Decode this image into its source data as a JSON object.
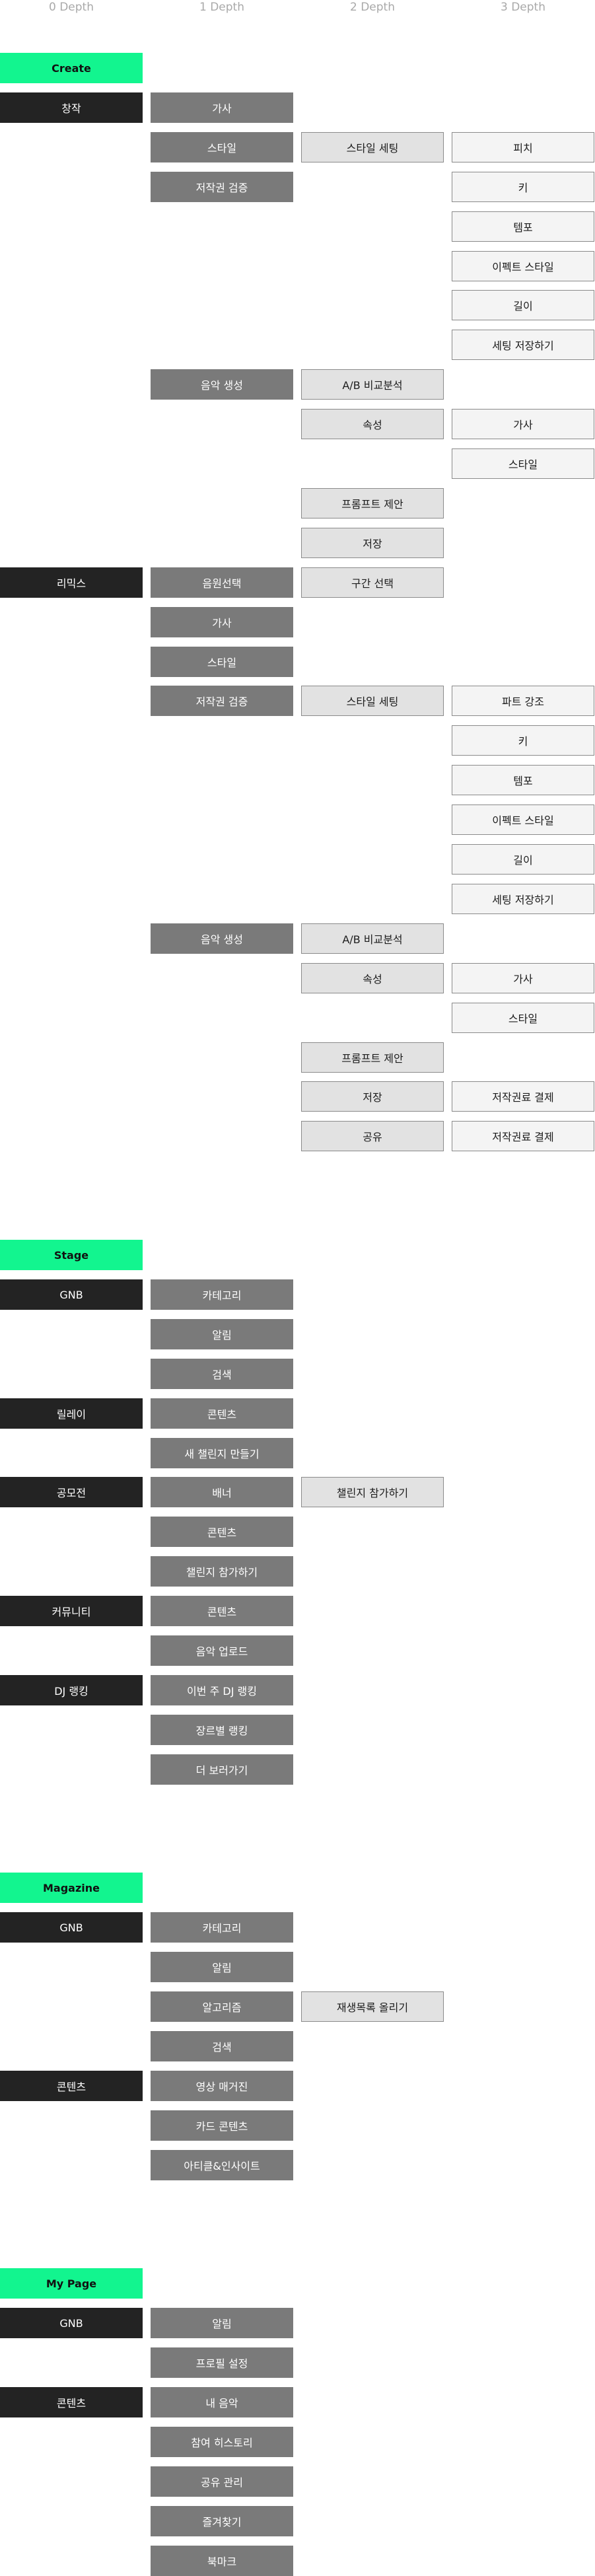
{
  "headers": [
    "0 Depth",
    "1 Depth",
    "2 Depth",
    "3 Depth"
  ],
  "nodes": [
    {
      "r": 0,
      "c": 0,
      "t": "section",
      "label": "Create"
    },
    {
      "r": 1,
      "c": 0,
      "t": "d0",
      "label": "창작"
    },
    {
      "r": 1,
      "c": 1,
      "t": "d1",
      "label": "가사"
    },
    {
      "r": 2,
      "c": 1,
      "t": "d1",
      "label": "스타일"
    },
    {
      "r": 2,
      "c": 2,
      "t": "d2",
      "label": "스타일 세팅"
    },
    {
      "r": 2,
      "c": 3,
      "t": "d3",
      "label": "피치"
    },
    {
      "r": 3,
      "c": 1,
      "t": "d1",
      "label": "저작권 검증"
    },
    {
      "r": 3,
      "c": 3,
      "t": "d3",
      "label": "키"
    },
    {
      "r": 4,
      "c": 3,
      "t": "d3",
      "label": "템포"
    },
    {
      "r": 5,
      "c": 3,
      "t": "d3",
      "label": "이펙트 스타일"
    },
    {
      "r": 6,
      "c": 3,
      "t": "d3",
      "label": "길이"
    },
    {
      "r": 7,
      "c": 3,
      "t": "d3",
      "label": "세팅 저장하기"
    },
    {
      "r": 8,
      "c": 1,
      "t": "d1",
      "label": "음악 생성"
    },
    {
      "r": 8,
      "c": 2,
      "t": "d2",
      "label": "A/B 비교분석"
    },
    {
      "r": 9,
      "c": 2,
      "t": "d2",
      "label": "속성"
    },
    {
      "r": 9,
      "c": 3,
      "t": "d3",
      "label": "가사"
    },
    {
      "r": 10,
      "c": 3,
      "t": "d3",
      "label": "스타일"
    },
    {
      "r": 11,
      "c": 2,
      "t": "d2",
      "label": "프롬프트 제안"
    },
    {
      "r": 12,
      "c": 2,
      "t": "d2",
      "label": "저장"
    },
    {
      "r": 13,
      "c": 0,
      "t": "d0",
      "label": "리믹스"
    },
    {
      "r": 13,
      "c": 1,
      "t": "d1",
      "label": "음원선택"
    },
    {
      "r": 13,
      "c": 2,
      "t": "d2",
      "label": "구간 선택"
    },
    {
      "r": 14,
      "c": 1,
      "t": "d1",
      "label": "가사"
    },
    {
      "r": 15,
      "c": 1,
      "t": "d1",
      "label": "스타일"
    },
    {
      "r": 16,
      "c": 1,
      "t": "d1",
      "label": "저작권 검증"
    },
    {
      "r": 16,
      "c": 2,
      "t": "d2",
      "label": "스타일 세팅"
    },
    {
      "r": 16,
      "c": 3,
      "t": "d3",
      "label": "파트 강조"
    },
    {
      "r": 17,
      "c": 3,
      "t": "d3",
      "label": "키"
    },
    {
      "r": 18,
      "c": 3,
      "t": "d3",
      "label": "템포"
    },
    {
      "r": 19,
      "c": 3,
      "t": "d3",
      "label": "이펙트 스타일"
    },
    {
      "r": 20,
      "c": 3,
      "t": "d3",
      "label": "길이"
    },
    {
      "r": 21,
      "c": 3,
      "t": "d3",
      "label": "세팅 저장하기"
    },
    {
      "r": 22,
      "c": 1,
      "t": "d1",
      "label": "음악 생성"
    },
    {
      "r": 22,
      "c": 2,
      "t": "d2",
      "label": "A/B 비교분석"
    },
    {
      "r": 23,
      "c": 2,
      "t": "d2",
      "label": "속성"
    },
    {
      "r": 23,
      "c": 3,
      "t": "d3",
      "label": "가사"
    },
    {
      "r": 24,
      "c": 3,
      "t": "d3",
      "label": "스타일"
    },
    {
      "r": 25,
      "c": 2,
      "t": "d2",
      "label": "프롬프트 제안"
    },
    {
      "r": 26,
      "c": 2,
      "t": "d2",
      "label": "저장"
    },
    {
      "r": 26,
      "c": 3,
      "t": "d3",
      "label": "저작권료 결제"
    },
    {
      "r": 27,
      "c": 2,
      "t": "d2",
      "label": "공유"
    },
    {
      "r": 27,
      "c": 3,
      "t": "d3",
      "label": "저작권료 결제"
    },
    {
      "r": 30,
      "c": 0,
      "t": "section",
      "label": "Stage"
    },
    {
      "r": 31,
      "c": 0,
      "t": "d0",
      "label": "GNB"
    },
    {
      "r": 31,
      "c": 1,
      "t": "d1",
      "label": "카테고리"
    },
    {
      "r": 32,
      "c": 1,
      "t": "d1",
      "label": "알림"
    },
    {
      "r": 33,
      "c": 1,
      "t": "d1",
      "label": "검색"
    },
    {
      "r": 34,
      "c": 0,
      "t": "d0",
      "label": "릴레이"
    },
    {
      "r": 34,
      "c": 1,
      "t": "d1",
      "label": "콘텐츠"
    },
    {
      "r": 35,
      "c": 1,
      "t": "d1",
      "label": "새 챌린지 만들기"
    },
    {
      "r": 36,
      "c": 0,
      "t": "d0",
      "label": "공모전"
    },
    {
      "r": 36,
      "c": 1,
      "t": "d1",
      "label": "배너"
    },
    {
      "r": 36,
      "c": 2,
      "t": "d2",
      "label": "챌린지 참가하기"
    },
    {
      "r": 37,
      "c": 1,
      "t": "d1",
      "label": "콘텐츠"
    },
    {
      "r": 38,
      "c": 1,
      "t": "d1",
      "label": "챌린지 참가하기"
    },
    {
      "r": 39,
      "c": 0,
      "t": "d0",
      "label": "커뮤니티"
    },
    {
      "r": 39,
      "c": 1,
      "t": "d1",
      "label": "콘텐츠"
    },
    {
      "r": 40,
      "c": 1,
      "t": "d1",
      "label": "음악 업로드"
    },
    {
      "r": 41,
      "c": 0,
      "t": "d0",
      "label": "DJ 랭킹"
    },
    {
      "r": 41,
      "c": 1,
      "t": "d1",
      "label": "이번 주 DJ 랭킹"
    },
    {
      "r": 42,
      "c": 1,
      "t": "d1",
      "label": "장르별 랭킹"
    },
    {
      "r": 43,
      "c": 1,
      "t": "d1",
      "label": "더 보러가기"
    },
    {
      "r": 46,
      "c": 0,
      "t": "section",
      "label": "Magazine"
    },
    {
      "r": 47,
      "c": 0,
      "t": "d0",
      "label": "GNB"
    },
    {
      "r": 47,
      "c": 1,
      "t": "d1",
      "label": "카테고리"
    },
    {
      "r": 48,
      "c": 1,
      "t": "d1",
      "label": "알림"
    },
    {
      "r": 49,
      "c": 1,
      "t": "d1",
      "label": "알고리즘"
    },
    {
      "r": 49,
      "c": 2,
      "t": "d2",
      "label": "재생목록 올리기"
    },
    {
      "r": 50,
      "c": 1,
      "t": "d1",
      "label": "검색"
    },
    {
      "r": 51,
      "c": 0,
      "t": "d0",
      "label": "콘텐츠"
    },
    {
      "r": 51,
      "c": 1,
      "t": "d1",
      "label": "영상 매거진"
    },
    {
      "r": 52,
      "c": 1,
      "t": "d1",
      "label": "카드 콘텐츠"
    },
    {
      "r": 53,
      "c": 1,
      "t": "d1",
      "label": "아티클&인사이트"
    },
    {
      "r": 56,
      "c": 0,
      "t": "section",
      "label": "My Page"
    },
    {
      "r": 57,
      "c": 0,
      "t": "d0",
      "label": "GNB"
    },
    {
      "r": 57,
      "c": 1,
      "t": "d1",
      "label": "알림"
    },
    {
      "r": 58,
      "c": 1,
      "t": "d1",
      "label": "프로필 설정"
    },
    {
      "r": 59,
      "c": 0,
      "t": "d0",
      "label": "콘텐츠"
    },
    {
      "r": 59,
      "c": 1,
      "t": "d1",
      "label": "내 음악"
    },
    {
      "r": 60,
      "c": 1,
      "t": "d1",
      "label": "참여 히스토리"
    },
    {
      "r": 61,
      "c": 1,
      "t": "d1",
      "label": "공유 관리"
    },
    {
      "r": 62,
      "c": 1,
      "t": "d1",
      "label": "즐겨찾기"
    },
    {
      "r": 63,
      "c": 1,
      "t": "d1",
      "label": "북마크"
    }
  ]
}
